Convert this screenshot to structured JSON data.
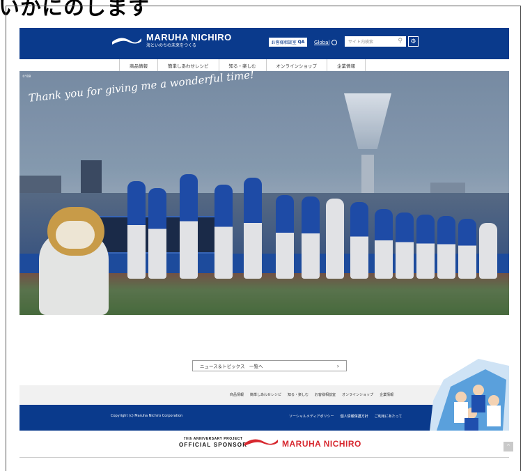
{
  "top_partial_text": "いかにのします",
  "header": {
    "brand_name": "MARUHA NICHIRO",
    "tagline": "海といのちの未来をつくる",
    "inquiry_label": "お客様相談室",
    "inquiry_icon": "QA",
    "global_label": "Global",
    "search_placeholder": "サイト内検索",
    "brand_color": "#0a3a8c"
  },
  "nav": {
    "items": [
      "商品情報",
      "簡単しあわせレシピ",
      "知る・楽しむ",
      "オンラインショップ",
      "企業情報"
    ]
  },
  "hero": {
    "corner_text": "©YDB",
    "slogan": "Thank you for giving me a wonderful time!"
  },
  "news": {
    "label": "ニュース＆トピックス　一覧へ",
    "chevron": "›"
  },
  "footer": {
    "nav_items": [
      "商品情報",
      "簡単しあわせレシピ",
      "知る・楽しむ",
      "お客様相談室",
      "オンラインショップ",
      "企業情報"
    ],
    "copyright": "Copyright (c) Maruha Nichiro Corporation",
    "links": [
      "ソーシャルメディアポリシー",
      "個人情報保護方針",
      "ご利用にあたって"
    ]
  },
  "sponsor": {
    "line1": "70th ANNIVERSARY PROJECT",
    "line2": "OFFICIAL SPONSOR",
    "brand": "MARUHA NICHIRO",
    "brand_color": "#d7282f"
  },
  "page_top_label": "^"
}
